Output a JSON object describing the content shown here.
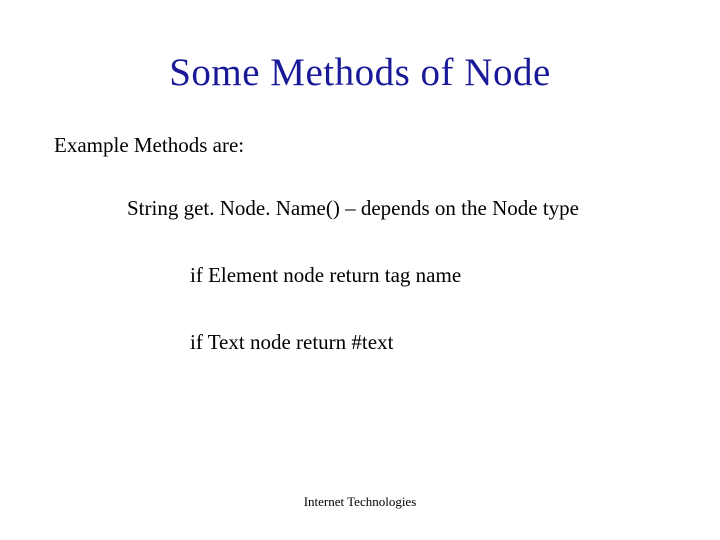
{
  "title": "Some Methods of Node",
  "intro": "Example Methods are:",
  "method": "String get. Node. Name() – depends on the Node type",
  "detail1": "if Element node return tag name",
  "detail2": "if Text node return #text",
  "footer": "Internet Technologies"
}
